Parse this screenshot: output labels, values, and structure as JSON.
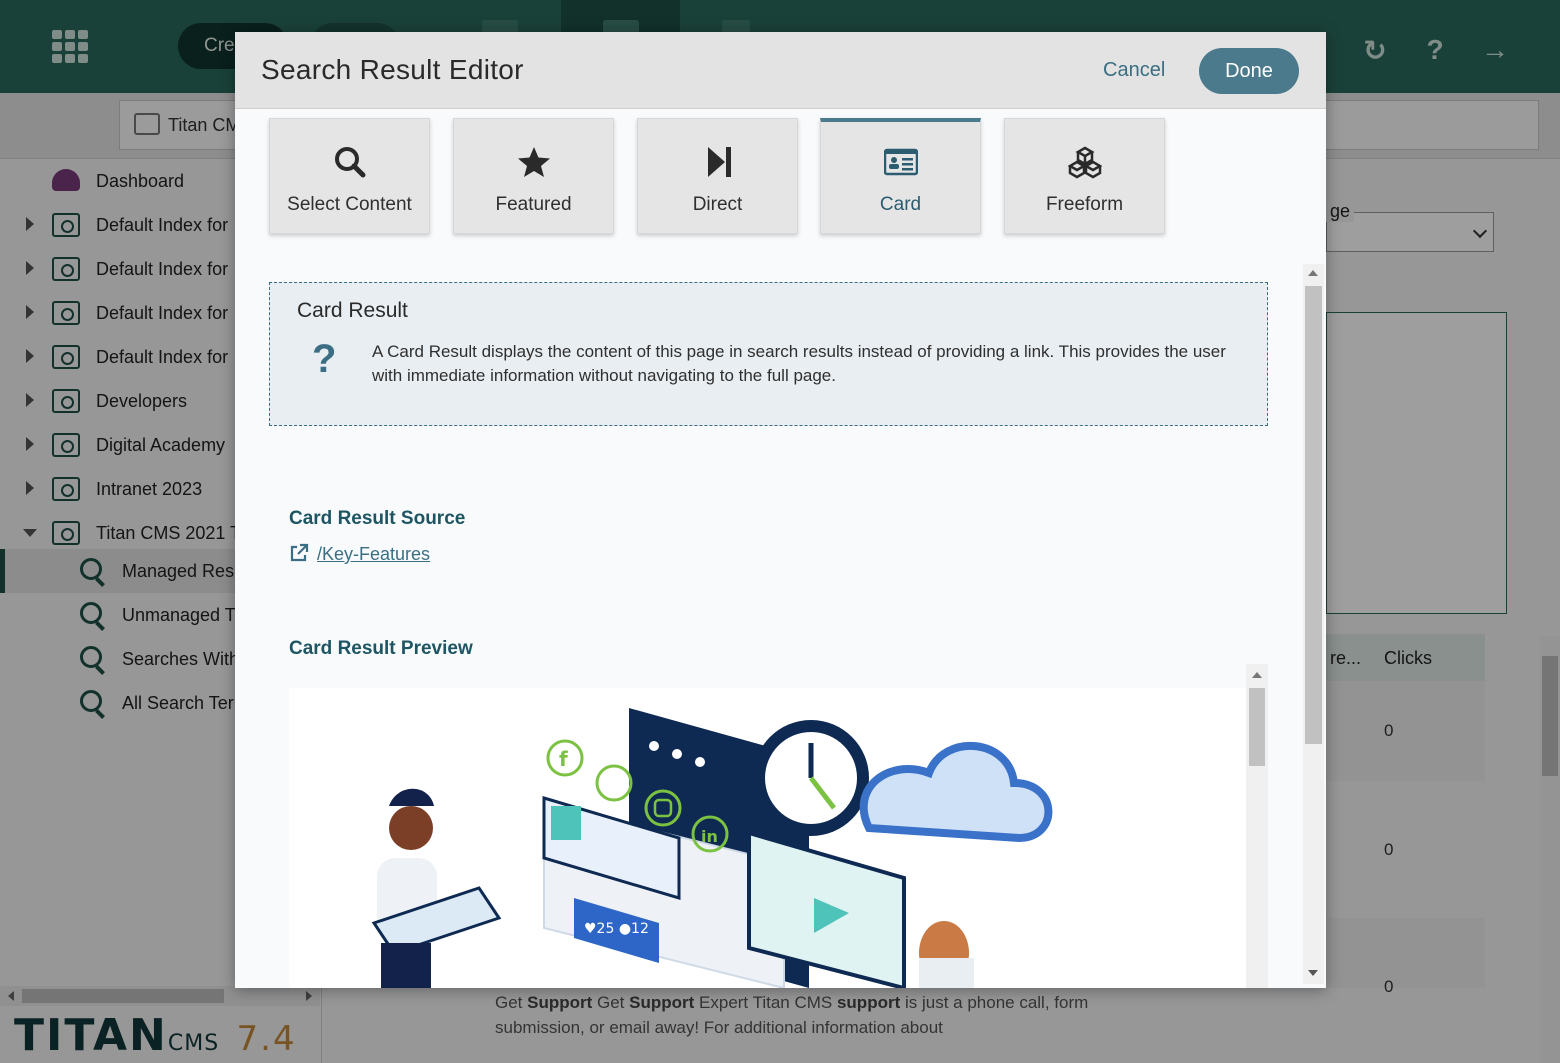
{
  "app": {
    "create_label": "Cre",
    "path_text": "Titan CM",
    "legend_partial": "ge",
    "table": {
      "col_partial": "re...",
      "clicks": "Clicks",
      "values": [
        "0",
        "0",
        "0"
      ]
    },
    "bottom_snippet": {
      "p1": "Get ",
      "b1": "Support",
      "p2": " Get ",
      "b2": "Support",
      "p3": " Expert Titan CMS ",
      "b3": "support",
      "p4": " is just a phone call, form submission, or email away! For additional information about"
    },
    "logo": {
      "word": "TITAN",
      "cms": "CMS",
      "version": "7.4"
    },
    "colors": {
      "topbar": "#2b6a5c",
      "accent": "#4a7a8c",
      "brand_dark": "#12373a"
    }
  },
  "sidebar": {
    "items": [
      {
        "label": "Dashboard",
        "icon": "dashboard-icon"
      },
      {
        "label": "Default Index for",
        "icon": "folder-search-icon"
      },
      {
        "label": "Default Index for",
        "icon": "folder-search-icon"
      },
      {
        "label": "Default Index for",
        "icon": "folder-search-icon"
      },
      {
        "label": "Default Index for",
        "icon": "folder-search-icon"
      },
      {
        "label": "Developers",
        "icon": "folder-search-icon"
      },
      {
        "label": "Digital Academy",
        "icon": "folder-search-icon"
      },
      {
        "label": "Intranet 2023",
        "icon": "folder-search-icon"
      },
      {
        "label": "Titan CMS 2021 T",
        "icon": "folder-search-icon"
      }
    ],
    "children": [
      {
        "label": "Managed Resu",
        "selected": true
      },
      {
        "label": "Unmanaged T"
      },
      {
        "label": "Searches With"
      },
      {
        "label": "All Search Terr"
      }
    ]
  },
  "modal": {
    "title": "Search Result Editor",
    "cancel": "Cancel",
    "done": "Done",
    "modes": [
      {
        "label": "Select Content",
        "icon": "search-icon"
      },
      {
        "label": "Featured",
        "icon": "star-icon"
      },
      {
        "label": "Direct",
        "icon": "skip-forward-icon"
      },
      {
        "label": "Card",
        "icon": "id-card-icon",
        "active": true
      },
      {
        "label": "Freeform",
        "icon": "cubes-icon"
      }
    ],
    "info": {
      "title": "Card Result",
      "text": "A Card Result displays the content of this page in search results instead of providing a link. This provides the user with immediate information without navigating to the full page."
    },
    "source": {
      "title": "Card Result Source",
      "link": "/Key-Features"
    },
    "preview": {
      "title": "Card Result Preview"
    }
  }
}
